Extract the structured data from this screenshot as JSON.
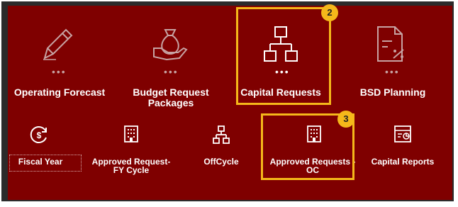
{
  "colors": {
    "panel_bg": "#7f0000",
    "frame": "#2b2b2b",
    "highlight": "#f5b81a",
    "icon_muted": "#c7a3a3",
    "icon_bright": "#ffffff"
  },
  "top_tiles": [
    {
      "label": "Operating Forecast",
      "icon": "pencil-icon",
      "dots": "•••"
    },
    {
      "label": "Budget Request Packages",
      "icon": "money-bag-hand-icon",
      "dots": "•••"
    },
    {
      "label": "Capital Requests",
      "icon": "hierarchy-icon",
      "dots": "•••"
    },
    {
      "label": "BSD Planning",
      "icon": "document-percent-icon",
      "dots": "•••"
    }
  ],
  "bottom_tiles": [
    {
      "label": "Fiscal Year",
      "icon": "dollar-cycle-icon"
    },
    {
      "label": "Approved Request-\nFY Cycle",
      "icon": "building-icon"
    },
    {
      "label": "OffCycle",
      "icon": "hierarchy-small-icon"
    },
    {
      "label": "Approved Requests -\nOC",
      "icon": "building-icon"
    },
    {
      "label": "Capital Reports",
      "icon": "report-chart-icon"
    }
  ],
  "badges": {
    "first": "2",
    "second": "3"
  }
}
